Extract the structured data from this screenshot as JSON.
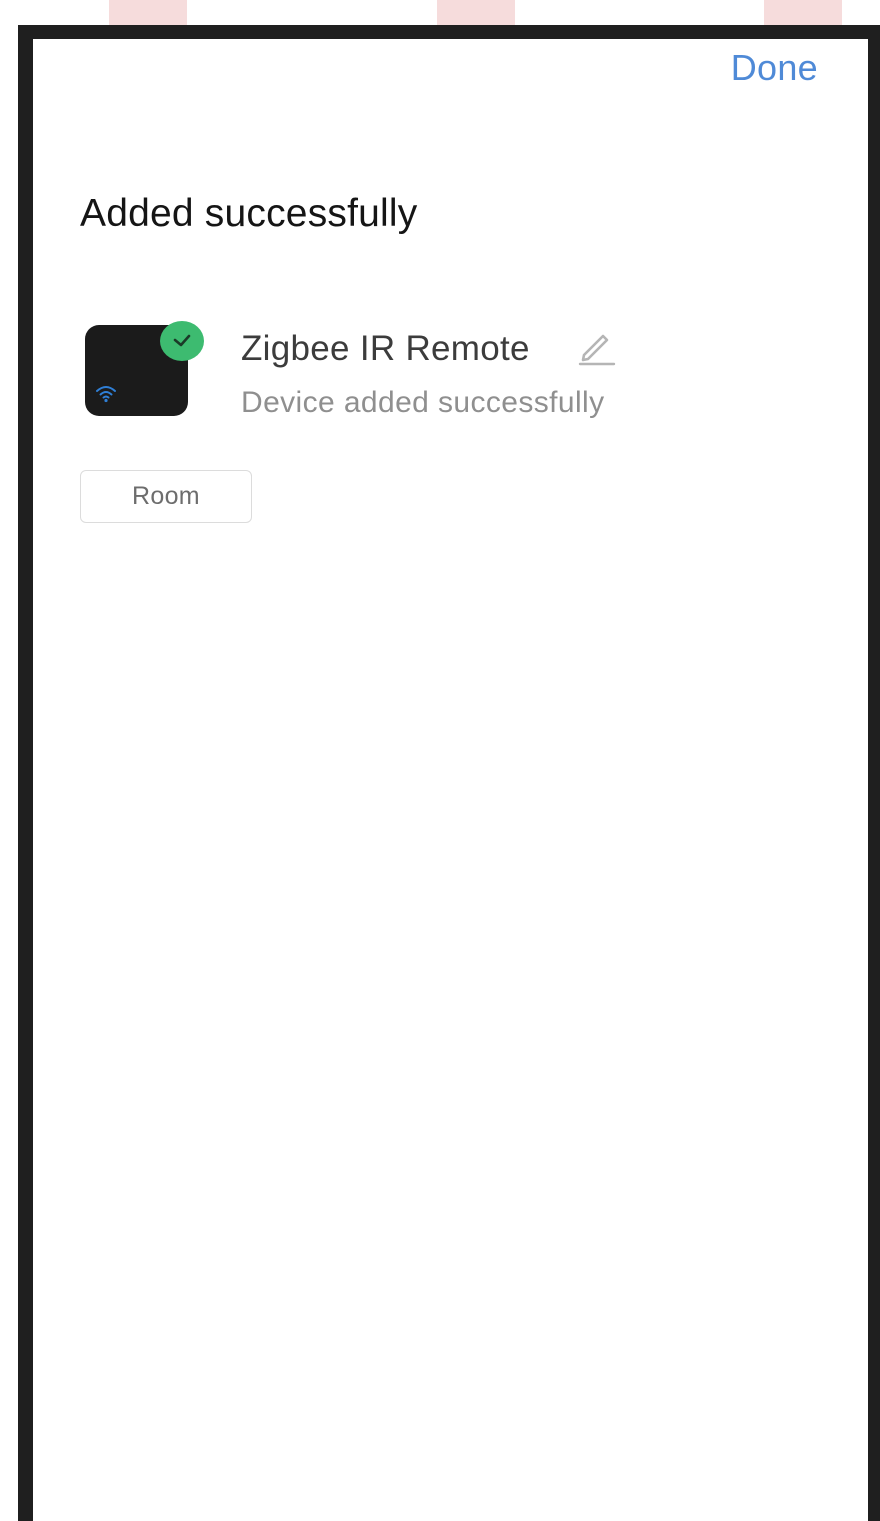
{
  "header": {
    "done_label": "Done"
  },
  "title": "Added successfully",
  "device": {
    "name": "Zigbee IR Remote",
    "status": "Device added successfully",
    "icons": [
      "wifi-icon",
      "check-icon",
      "edit-pencil-icon"
    ]
  },
  "room_button_label": "Room",
  "colors": {
    "accent": "#4f8ad7",
    "success": "#3dbb70",
    "frame": "#1f1f1f",
    "device_thumb": "#1b1b1b",
    "top_tabs": "#f6dcdc"
  }
}
